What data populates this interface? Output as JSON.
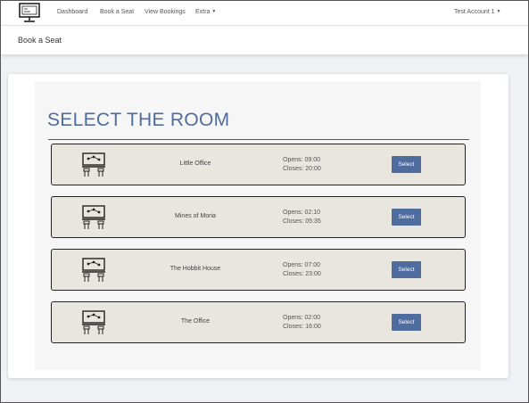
{
  "nav": {
    "links": [
      "Dashboard",
      "Book a Seat",
      "View Bookings",
      "Extra"
    ],
    "account": "Test Account 1"
  },
  "page": {
    "subtitle": "Book a Seat",
    "heading": "SELECT THE ROOM"
  },
  "rooms": [
    {
      "name": "Little Office",
      "opens": "Opens: 09:00",
      "closes": "Closes: 20:00",
      "button": "Select"
    },
    {
      "name": "Mines of Moria",
      "opens": "Opens: 02:10",
      "closes": "Closes: 05:35",
      "button": "Select"
    },
    {
      "name": "The Hobbit House",
      "opens": "Opens: 07:00",
      "closes": "Closes: 23:00",
      "button": "Select"
    },
    {
      "name": "The Office",
      "opens": "Opens: 02:00",
      "closes": "Closes: 16:00",
      "button": "Select"
    }
  ],
  "icons": {
    "logo": "monitor-icon",
    "room": "desk-workstation-icon",
    "dropdown": "chevron-down-icon"
  },
  "colors": {
    "accent": "#4e6c9e",
    "room_bg": "#e9e5df",
    "page_bg": "#f0f1f4"
  }
}
